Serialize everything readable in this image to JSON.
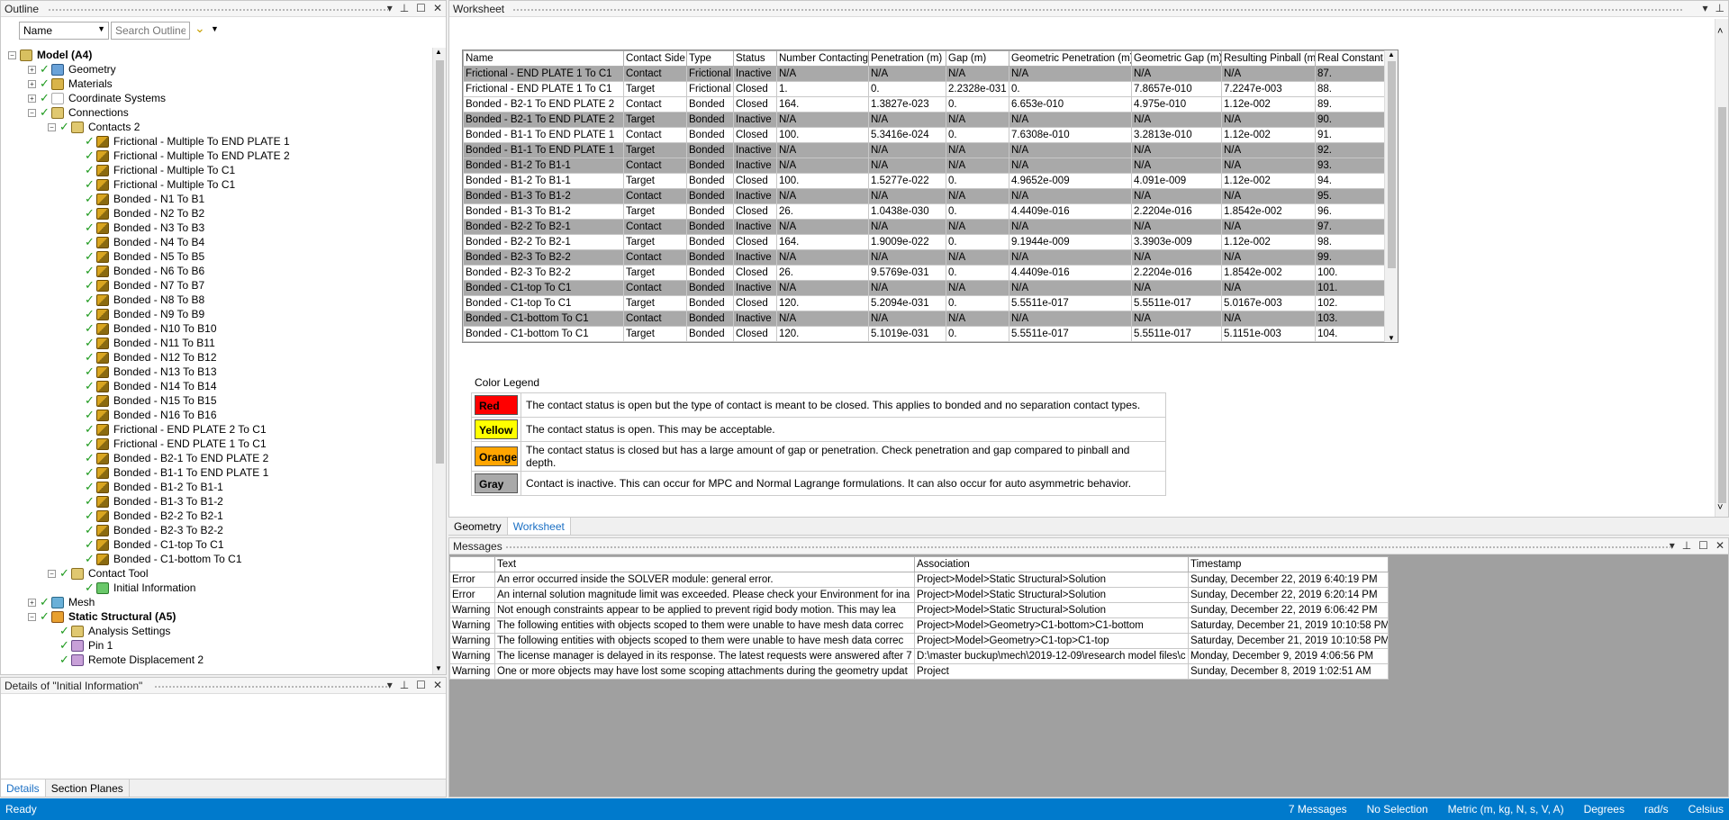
{
  "outline": {
    "title": "Outline",
    "name_select": "Name",
    "search_placeholder": "Search Outline",
    "tree": [
      {
        "label": "Model (A4)",
        "level": 0,
        "exp": "-",
        "check": false,
        "icon": "ico-model",
        "bold": true
      },
      {
        "label": "Geometry",
        "level": 1,
        "exp": "+",
        "check": true,
        "icon": "ico-geom"
      },
      {
        "label": "Materials",
        "level": 1,
        "exp": "+",
        "check": true,
        "icon": "ico-mat"
      },
      {
        "label": "Coordinate Systems",
        "level": 1,
        "exp": "+",
        "check": true,
        "icon": "ico-coord"
      },
      {
        "label": "Connections",
        "level": 1,
        "exp": "-",
        "check": true,
        "icon": "ico-conn"
      },
      {
        "label": "Contacts 2",
        "level": 2,
        "exp": "-",
        "check": true,
        "icon": "ico-conn"
      },
      {
        "label": "Frictional - Multiple To END PLATE 1",
        "level": 3,
        "check": true,
        "icon": "ico-contact"
      },
      {
        "label": "Frictional - Multiple To END PLATE 2",
        "level": 3,
        "check": true,
        "icon": "ico-contact"
      },
      {
        "label": "Frictional - Multiple To C1",
        "level": 3,
        "check": true,
        "icon": "ico-contact"
      },
      {
        "label": "Frictional - Multiple To C1",
        "level": 3,
        "check": true,
        "icon": "ico-contact"
      },
      {
        "label": "Bonded - N1 To B1",
        "level": 3,
        "check": true,
        "icon": "ico-contact"
      },
      {
        "label": "Bonded - N2 To B2",
        "level": 3,
        "check": true,
        "icon": "ico-contact"
      },
      {
        "label": "Bonded - N3 To B3",
        "level": 3,
        "check": true,
        "icon": "ico-contact"
      },
      {
        "label": "Bonded - N4 To B4",
        "level": 3,
        "check": true,
        "icon": "ico-contact"
      },
      {
        "label": "Bonded - N5 To B5",
        "level": 3,
        "check": true,
        "icon": "ico-contact"
      },
      {
        "label": "Bonded - N6 To B6",
        "level": 3,
        "check": true,
        "icon": "ico-contact"
      },
      {
        "label": "Bonded - N7 To B7",
        "level": 3,
        "check": true,
        "icon": "ico-contact"
      },
      {
        "label": "Bonded - N8 To B8",
        "level": 3,
        "check": true,
        "icon": "ico-contact"
      },
      {
        "label": "Bonded - N9 To B9",
        "level": 3,
        "check": true,
        "icon": "ico-contact"
      },
      {
        "label": "Bonded - N10 To B10",
        "level": 3,
        "check": true,
        "icon": "ico-contact"
      },
      {
        "label": "Bonded - N11 To B11",
        "level": 3,
        "check": true,
        "icon": "ico-contact"
      },
      {
        "label": "Bonded - N12 To B12",
        "level": 3,
        "check": true,
        "icon": "ico-contact"
      },
      {
        "label": "Bonded - N13 To B13",
        "level": 3,
        "check": true,
        "icon": "ico-contact"
      },
      {
        "label": "Bonded - N14 To B14",
        "level": 3,
        "check": true,
        "icon": "ico-contact"
      },
      {
        "label": "Bonded - N15 To B15",
        "level": 3,
        "check": true,
        "icon": "ico-contact"
      },
      {
        "label": "Bonded - N16 To B16",
        "level": 3,
        "check": true,
        "icon": "ico-contact"
      },
      {
        "label": "Frictional - END PLATE 2 To C1",
        "level": 3,
        "check": true,
        "icon": "ico-contact"
      },
      {
        "label": "Frictional - END PLATE 1 To C1",
        "level": 3,
        "check": true,
        "icon": "ico-contact"
      },
      {
        "label": "Bonded - B2-1 To END PLATE 2",
        "level": 3,
        "check": true,
        "icon": "ico-contact"
      },
      {
        "label": "Bonded - B1-1 To END PLATE 1",
        "level": 3,
        "check": true,
        "icon": "ico-contact"
      },
      {
        "label": "Bonded - B1-2 To B1-1",
        "level": 3,
        "check": true,
        "icon": "ico-contact"
      },
      {
        "label": "Bonded - B1-3 To B1-2",
        "level": 3,
        "check": true,
        "icon": "ico-contact"
      },
      {
        "label": "Bonded - B2-2 To B2-1",
        "level": 3,
        "check": true,
        "icon": "ico-contact"
      },
      {
        "label": "Bonded - B2-3 To B2-2",
        "level": 3,
        "check": true,
        "icon": "ico-contact"
      },
      {
        "label": "Bonded - C1-top To C1",
        "level": 3,
        "check": true,
        "icon": "ico-contact"
      },
      {
        "label": "Bonded - C1-bottom To C1",
        "level": 3,
        "check": true,
        "icon": "ico-contact"
      },
      {
        "label": "Contact Tool",
        "level": 2,
        "exp": "-",
        "check": true,
        "icon": "ico-tool"
      },
      {
        "label": "Initial Information",
        "level": 3,
        "check": true,
        "icon": "ico-info"
      },
      {
        "label": "Mesh",
        "level": 1,
        "exp": "+",
        "check": true,
        "icon": "ico-mesh"
      },
      {
        "label": "Static Structural (A5)",
        "level": 1,
        "exp": "-",
        "check": true,
        "icon": "ico-static",
        "bold": true
      },
      {
        "label": "Analysis Settings",
        "level": 2,
        "check": true,
        "icon": "ico-tool"
      },
      {
        "label": "Pin 1",
        "level": 2,
        "check": true,
        "icon": "ico-pin"
      },
      {
        "label": "Remote Displacement 2",
        "level": 2,
        "check": true,
        "icon": "ico-pin"
      }
    ]
  },
  "details": {
    "title": "Details of \"Initial Information\"",
    "tabs": [
      "Details",
      "Section Planes"
    ]
  },
  "worksheet": {
    "title": "Worksheet",
    "columns": [
      "Name",
      "Contact Side",
      "Type",
      "Status",
      "Number Contacting",
      "Penetration (m)",
      "Gap (m)",
      "Geometric Penetration (m)",
      "Geometric Gap (m)",
      "Resulting Pinball (m)",
      "Real Constant"
    ],
    "rows": [
      {
        "cells": [
          "Frictional - END PLATE 1 To C1",
          "Contact",
          "Frictional",
          "Inactive",
          "N/A",
          "N/A",
          "N/A",
          "N/A",
          "N/A",
          "N/A",
          "87."
        ],
        "inactive": true
      },
      {
        "cells": [
          "Frictional - END PLATE 1 To C1",
          "Target",
          "Frictional",
          "Closed",
          "1.",
          "0.",
          "2.2328e-031",
          "0.",
          "7.8657e-010",
          "7.2247e-003",
          "88."
        ],
        "inactive": false
      },
      {
        "cells": [
          "Bonded - B2-1 To END PLATE 2",
          "Contact",
          "Bonded",
          "Closed",
          "164.",
          "1.3827e-023",
          "0.",
          "6.653e-010",
          "4.975e-010",
          "1.12e-002",
          "89."
        ],
        "inactive": false
      },
      {
        "cells": [
          "Bonded - B2-1 To END PLATE 2",
          "Target",
          "Bonded",
          "Inactive",
          "N/A",
          "N/A",
          "N/A",
          "N/A",
          "N/A",
          "N/A",
          "90."
        ],
        "inactive": true
      },
      {
        "cells": [
          "Bonded - B1-1 To END PLATE 1",
          "Contact",
          "Bonded",
          "Closed",
          "100.",
          "5.3416e-024",
          "0.",
          "7.6308e-010",
          "3.2813e-010",
          "1.12e-002",
          "91."
        ],
        "inactive": false
      },
      {
        "cells": [
          "Bonded - B1-1 To END PLATE 1",
          "Target",
          "Bonded",
          "Inactive",
          "N/A",
          "N/A",
          "N/A",
          "N/A",
          "N/A",
          "N/A",
          "92."
        ],
        "inactive": true
      },
      {
        "cells": [
          "Bonded - B1-2 To B1-1",
          "Contact",
          "Bonded",
          "Inactive",
          "N/A",
          "N/A",
          "N/A",
          "N/A",
          "N/A",
          "N/A",
          "93."
        ],
        "inactive": true
      },
      {
        "cells": [
          "Bonded - B1-2 To B1-1",
          "Target",
          "Bonded",
          "Closed",
          "100.",
          "1.5277e-022",
          "0.",
          "4.9652e-009",
          "4.091e-009",
          "1.12e-002",
          "94."
        ],
        "inactive": false
      },
      {
        "cells": [
          "Bonded - B1-3 To B1-2",
          "Contact",
          "Bonded",
          "Inactive",
          "N/A",
          "N/A",
          "N/A",
          "N/A",
          "N/A",
          "N/A",
          "95."
        ],
        "inactive": true
      },
      {
        "cells": [
          "Bonded - B1-3 To B1-2",
          "Target",
          "Bonded",
          "Closed",
          "26.",
          "1.0438e-030",
          "0.",
          "4.4409e-016",
          "2.2204e-016",
          "1.8542e-002",
          "96."
        ],
        "inactive": false
      },
      {
        "cells": [
          "Bonded - B2-2 To B2-1",
          "Contact",
          "Bonded",
          "Inactive",
          "N/A",
          "N/A",
          "N/A",
          "N/A",
          "N/A",
          "N/A",
          "97."
        ],
        "inactive": true
      },
      {
        "cells": [
          "Bonded - B2-2 To B2-1",
          "Target",
          "Bonded",
          "Closed",
          "164.",
          "1.9009e-022",
          "0.",
          "9.1944e-009",
          "3.3903e-009",
          "1.12e-002",
          "98."
        ],
        "inactive": false
      },
      {
        "cells": [
          "Bonded - B2-3 To B2-2",
          "Contact",
          "Bonded",
          "Inactive",
          "N/A",
          "N/A",
          "N/A",
          "N/A",
          "N/A",
          "N/A",
          "99."
        ],
        "inactive": true
      },
      {
        "cells": [
          "Bonded - B2-3 To B2-2",
          "Target",
          "Bonded",
          "Closed",
          "26.",
          "9.5769e-031",
          "0.",
          "4.4409e-016",
          "2.2204e-016",
          "1.8542e-002",
          "100."
        ],
        "inactive": false
      },
      {
        "cells": [
          "Bonded - C1-top To C1",
          "Contact",
          "Bonded",
          "Inactive",
          "N/A",
          "N/A",
          "N/A",
          "N/A",
          "N/A",
          "N/A",
          "101."
        ],
        "inactive": true
      },
      {
        "cells": [
          "Bonded - C1-top To C1",
          "Target",
          "Bonded",
          "Closed",
          "120.",
          "5.2094e-031",
          "0.",
          "5.5511e-017",
          "5.5511e-017",
          "5.0167e-003",
          "102."
        ],
        "inactive": false
      },
      {
        "cells": [
          "Bonded - C1-bottom To C1",
          "Contact",
          "Bonded",
          "Inactive",
          "N/A",
          "N/A",
          "N/A",
          "N/A",
          "N/A",
          "N/A",
          "103."
        ],
        "inactive": true
      },
      {
        "cells": [
          "Bonded - C1-bottom To C1",
          "Target",
          "Bonded",
          "Closed",
          "120.",
          "5.1019e-031",
          "0.",
          "5.5511e-017",
          "5.5511e-017",
          "5.1151e-003",
          "104."
        ],
        "inactive": false
      }
    ],
    "legend_title": "Color Legend",
    "legend": [
      {
        "label": "Red",
        "color": "#ff0000",
        "text": "The contact status is open but the type of contact is meant to be closed. This applies to bonded and no separation contact types."
      },
      {
        "label": "Yellow",
        "color": "#ffff00",
        "text": "The contact status is open. This may be acceptable."
      },
      {
        "label": "Orange",
        "color": "#ffa500",
        "text": "The contact status is closed but has a large amount of gap or penetration. Check penetration and gap compared to pinball and depth."
      },
      {
        "label": "Gray",
        "color": "#a9a9a9",
        "text": "Contact is inactive. This can occur for MPC and Normal Lagrange formulations. It can also occur for auto asymmetric behavior."
      }
    ],
    "tabs": [
      "Geometry",
      "Worksheet"
    ]
  },
  "messages": {
    "title": "Messages",
    "columns": [
      "Text",
      "Association",
      "Timestamp"
    ],
    "rows": [
      [
        "Error",
        "An error occurred inside the SOLVER module: general error.",
        "Project>Model>Static Structural>Solution",
        "Sunday, December 22, 2019 6:40:19 PM"
      ],
      [
        "Error",
        "An internal solution magnitude limit was exceeded. Please check your Environment for ina",
        "Project>Model>Static Structural>Solution",
        "Sunday, December 22, 2019 6:20:14 PM"
      ],
      [
        "Warning",
        "Not enough constraints appear to be applied to prevent rigid body motion.  This may lea",
        "Project>Model>Static Structural>Solution",
        "Sunday, December 22, 2019 6:06:42 PM"
      ],
      [
        "Warning",
        "The following entities with objects scoped to them were unable to have mesh data correc",
        "Project>Model>Geometry>C1-bottom>C1-bottom",
        "Saturday, December 21, 2019 10:10:58 PM"
      ],
      [
        "Warning",
        "The following entities with objects scoped to them were unable to have mesh data correc",
        "Project>Model>Geometry>C1-top>C1-top",
        "Saturday, December 21, 2019 10:10:58 PM"
      ],
      [
        "Warning",
        "The license manager is delayed in its response. The latest requests were answered after 7",
        "D:\\master buckup\\mech\\2019-12-09\\research model files\\c",
        "Monday, December 9, 2019 4:06:56 PM"
      ],
      [
        "Warning",
        "One or more objects may have lost some scoping attachments during the geometry updat",
        "Project",
        "Sunday, December 8, 2019 1:02:51 AM"
      ]
    ]
  },
  "status": {
    "ready": "Ready",
    "messages": "7 Messages",
    "selection": "No Selection",
    "units": "Metric (m, kg, N, s, V, A)",
    "angle": "Degrees",
    "rotvel": "rad/s",
    "temp": "Celsius"
  }
}
